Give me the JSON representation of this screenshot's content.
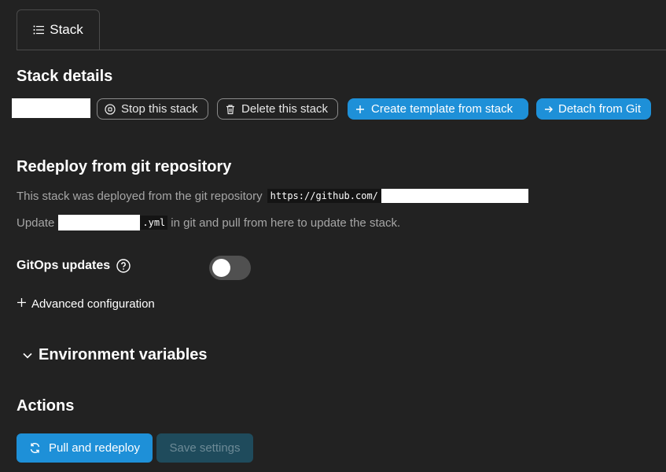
{
  "tabs": [
    {
      "label": "Stack",
      "icon": "list-icon"
    }
  ],
  "details": {
    "title": "Stack details",
    "buttons": {
      "stop": "Stop this stack",
      "delete": "Delete this stack",
      "create_template": "Create template from stack",
      "detach": "Detach from Git"
    }
  },
  "redeploy": {
    "title": "Redeploy from git repository",
    "deployed_text": "This stack was deployed from the git repository",
    "repo_url": "https://github.com/",
    "update_prefix": "Update",
    "file_suffix": ".yml",
    "update_suffix": "in git and pull from here to update the stack."
  },
  "gitops": {
    "label": "GitOps updates",
    "enabled": false
  },
  "advanced": {
    "label": "Advanced configuration"
  },
  "env": {
    "title": "Environment variables"
  },
  "actions": {
    "title": "Actions",
    "pull_label": "Pull and redeploy",
    "save_label": "Save settings"
  },
  "colors": {
    "background": "#222222",
    "primary": "#1e90d8",
    "disabled": "#1f4b5c"
  }
}
